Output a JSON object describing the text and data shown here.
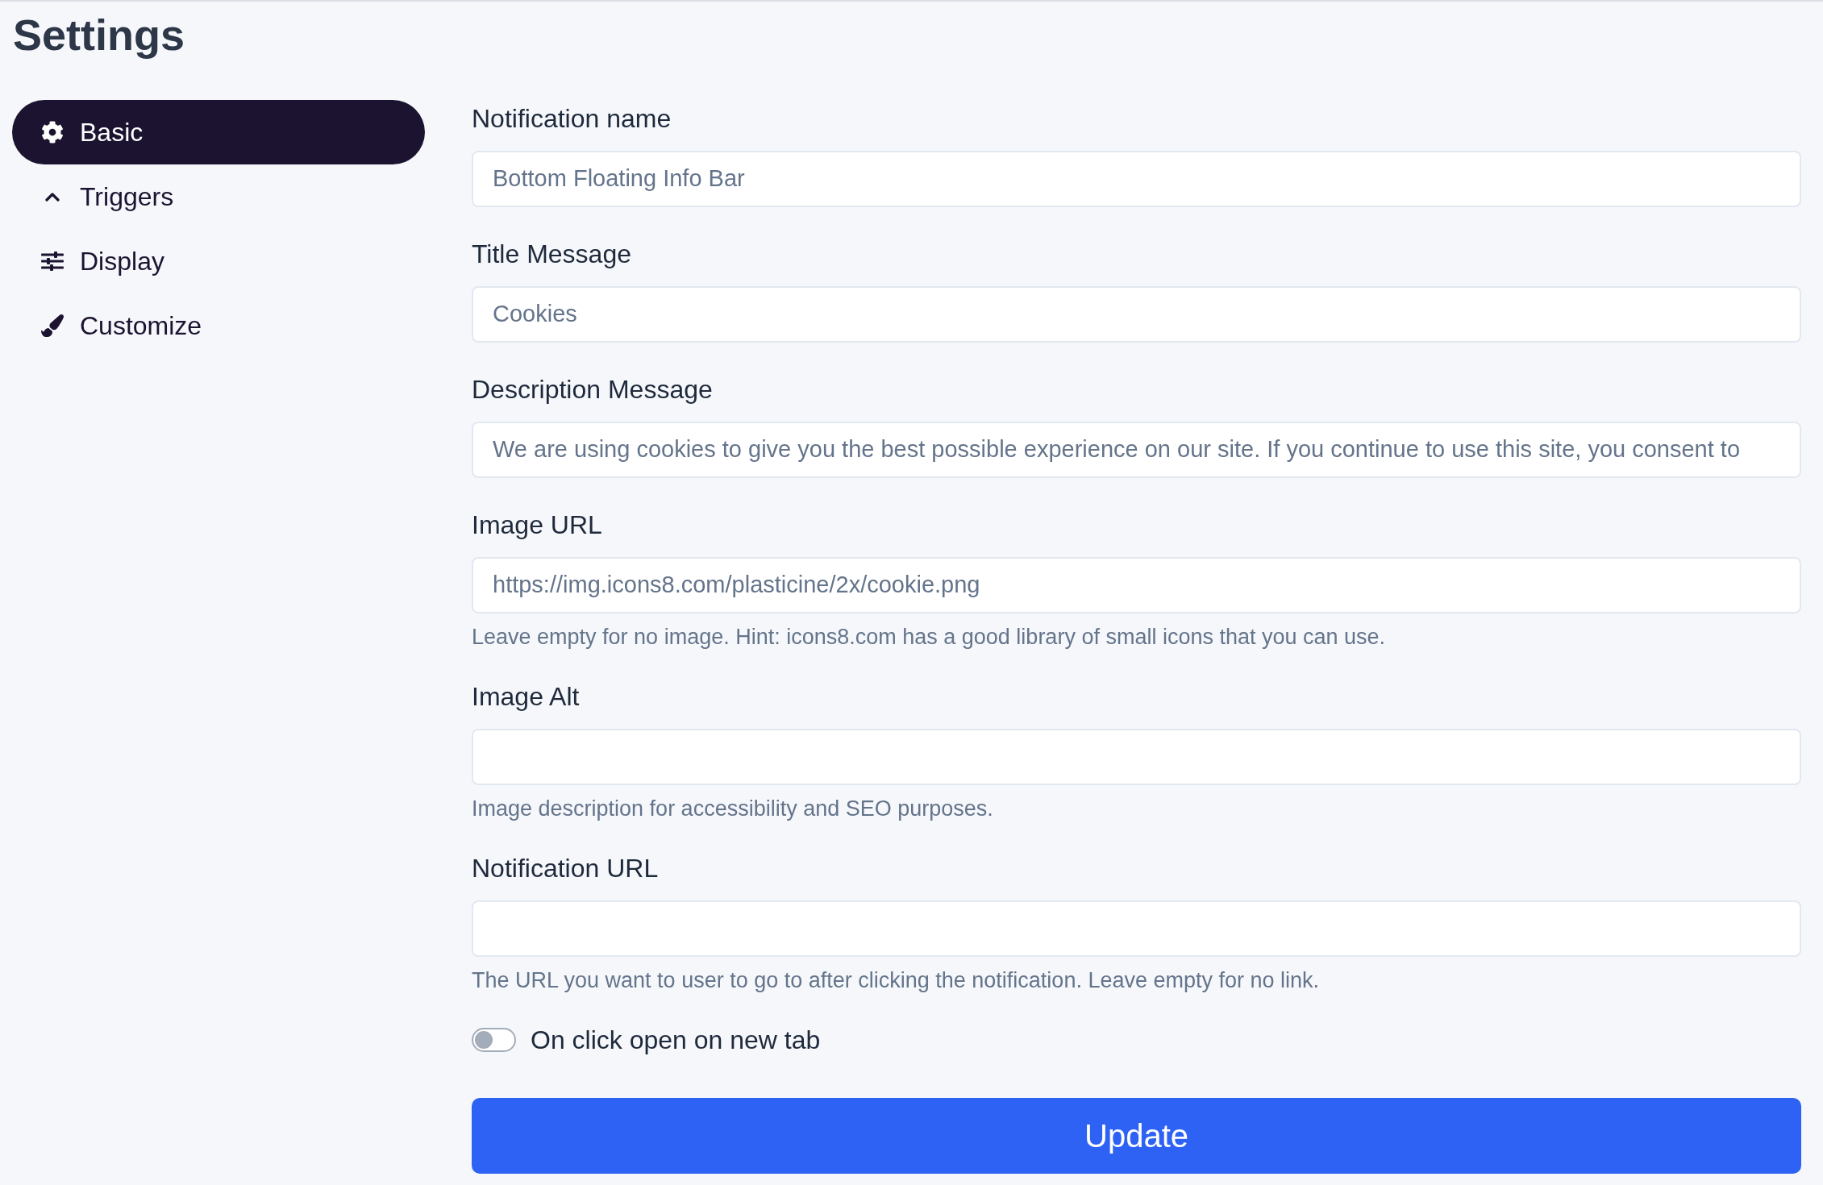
{
  "page": {
    "title": "Settings"
  },
  "sidebar": {
    "items": [
      {
        "label": "Basic",
        "selected": true
      },
      {
        "label": "Triggers",
        "selected": false
      },
      {
        "label": "Display",
        "selected": false
      },
      {
        "label": "Customize",
        "selected": false
      }
    ]
  },
  "form": {
    "fields": [
      {
        "label": "Notification name",
        "value": "Bottom Floating Info Bar"
      },
      {
        "label": "Title Message",
        "value": "Cookies"
      },
      {
        "label": "Description Message",
        "value": "We are using cookies to give you the best possible experience on our site. If you continue to use this site, you consent to"
      },
      {
        "label": "Image URL",
        "value": "https://img.icons8.com/plasticine/2x/cookie.png",
        "help": "Leave empty for no image. Hint: icons8.com has a good library of small icons that you can use."
      },
      {
        "label": "Image Alt",
        "help": "Image description for accessibility and SEO purposes."
      },
      {
        "label": "Notification URL",
        "help": "The URL you want to user to go to after clicking the notification. Leave empty for no link."
      }
    ],
    "toggle": {
      "label": "On click open on new tab",
      "on": false
    },
    "submit_button": {
      "label": "Update"
    }
  }
}
